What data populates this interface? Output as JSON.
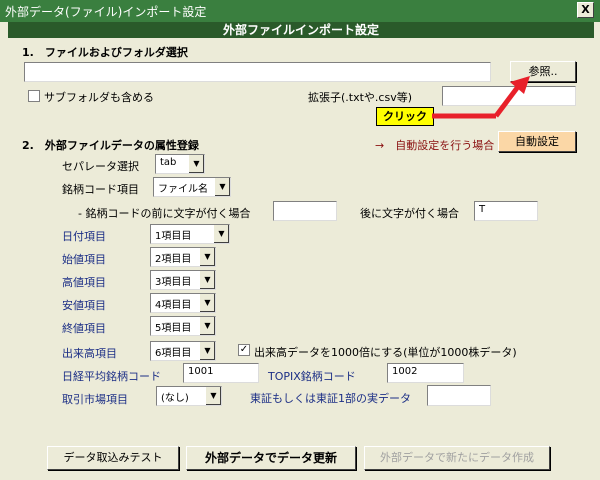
{
  "window": {
    "title": "外部データ(ファイル)インポート設定",
    "close_label": "X"
  },
  "header": "外部ファイルインポート設定",
  "section1": {
    "title": "1.　ファイルおよびフォルダ選択",
    "path_value": "",
    "browse_label": "参照..",
    "subfolder_label": "サブフォルダも含める",
    "subfolder_checked": false,
    "ext_label": "拡張子(.txtや.csv等)",
    "ext_value": "",
    "callout": "クリック"
  },
  "section2": {
    "title": "2.　外部ファイルデータの属性登録",
    "auto_hint": "→　自動設定を行う場合",
    "auto_button": "自動設定",
    "separator_label": "セパレータ選択",
    "separator_value": "tab",
    "code_item_label": "銘柄コード項目",
    "code_item_value": "ファイル名",
    "prefix_label": "- 銘柄コードの前に文字が付く場合",
    "prefix_value": "",
    "suffix_label": "後に文字が付く場合",
    "suffix_value": "T",
    "items": [
      {
        "label": "日付項目",
        "value": "1項目目"
      },
      {
        "label": "始値項目",
        "value": "2項目目"
      },
      {
        "label": "高値項目",
        "value": "3項目目"
      },
      {
        "label": "安値項目",
        "value": "4項目目"
      },
      {
        "label": "終値項目",
        "value": "5項目目"
      },
      {
        "label": "出来高項目",
        "value": "6項目目"
      }
    ],
    "volume_check_label": "出来高データを1000倍にする(単位が1000株データ)",
    "volume_checked": true,
    "nikkei_label": "日経平均銘柄コード",
    "nikkei_value": "1001",
    "topix_label": "TOPIX銘柄コード",
    "topix_value": "1002",
    "market_label": "取引市場項目",
    "market_value": "(なし)",
    "tse_label": "東証もしくは東証1部の実データ",
    "tse_value": ""
  },
  "footer": {
    "test_button": "データ取込みテスト",
    "update_button": "外部データでデータ更新",
    "create_button": "外部データで新たにデータ作成"
  },
  "colors": {
    "titlebar": "#3a7f3f",
    "header": "#2a5a2a",
    "accent_orange": "#fbd7a6",
    "callout": "#ffff00",
    "arrow": "#e8202a"
  }
}
